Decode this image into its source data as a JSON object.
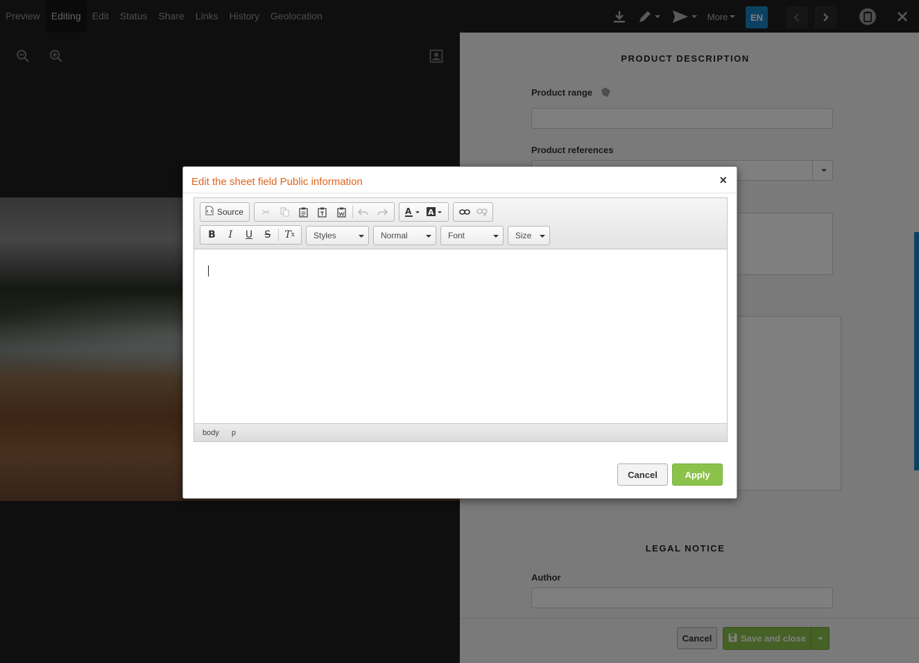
{
  "topbar": {
    "tabs": [
      {
        "label": "Preview"
      },
      {
        "label": "Editing"
      },
      {
        "label": "Edit"
      },
      {
        "label": "Status"
      },
      {
        "label": "Share"
      },
      {
        "label": "Links"
      },
      {
        "label": "History"
      },
      {
        "label": "Geolocation"
      }
    ],
    "more_label": "More",
    "language": "EN",
    "icons": [
      "download-icon",
      "pencil-icon",
      "send-icon",
      "previous-icon",
      "next-icon",
      "clipboard-icon",
      "close-icon"
    ]
  },
  "viewer": {
    "icons": [
      "zoom-out-icon",
      "zoom-in-icon",
      "portrait-icon"
    ]
  },
  "panel": {
    "section_product": "PRODUCT DESCRIPTION",
    "product_range_label": "Product range",
    "product_references_label": "Product references",
    "section_legal": "LEGAL NOTICE",
    "author_label": "Author",
    "cancel_label": "Cancel",
    "save_label": "Save and close"
  },
  "modal": {
    "title": "Edit the sheet field Public information",
    "close_symbol": "×",
    "toolbar": {
      "source_label": "Source",
      "styles_label": "Styles",
      "format_label": "Normal",
      "font_label": "Font",
      "size_label": "Size",
      "bold_label": "B",
      "italic_label": "I",
      "underline_label": "U",
      "strike_label": "S",
      "removeformat_label": "Tx"
    },
    "pathbar": [
      "body",
      "p"
    ],
    "cancel_label": "Cancel",
    "apply_label": "Apply"
  },
  "colors": {
    "accent_orange": "#e0621c",
    "apply_green": "#8bc34a",
    "language_blue": "#1a82c4"
  }
}
